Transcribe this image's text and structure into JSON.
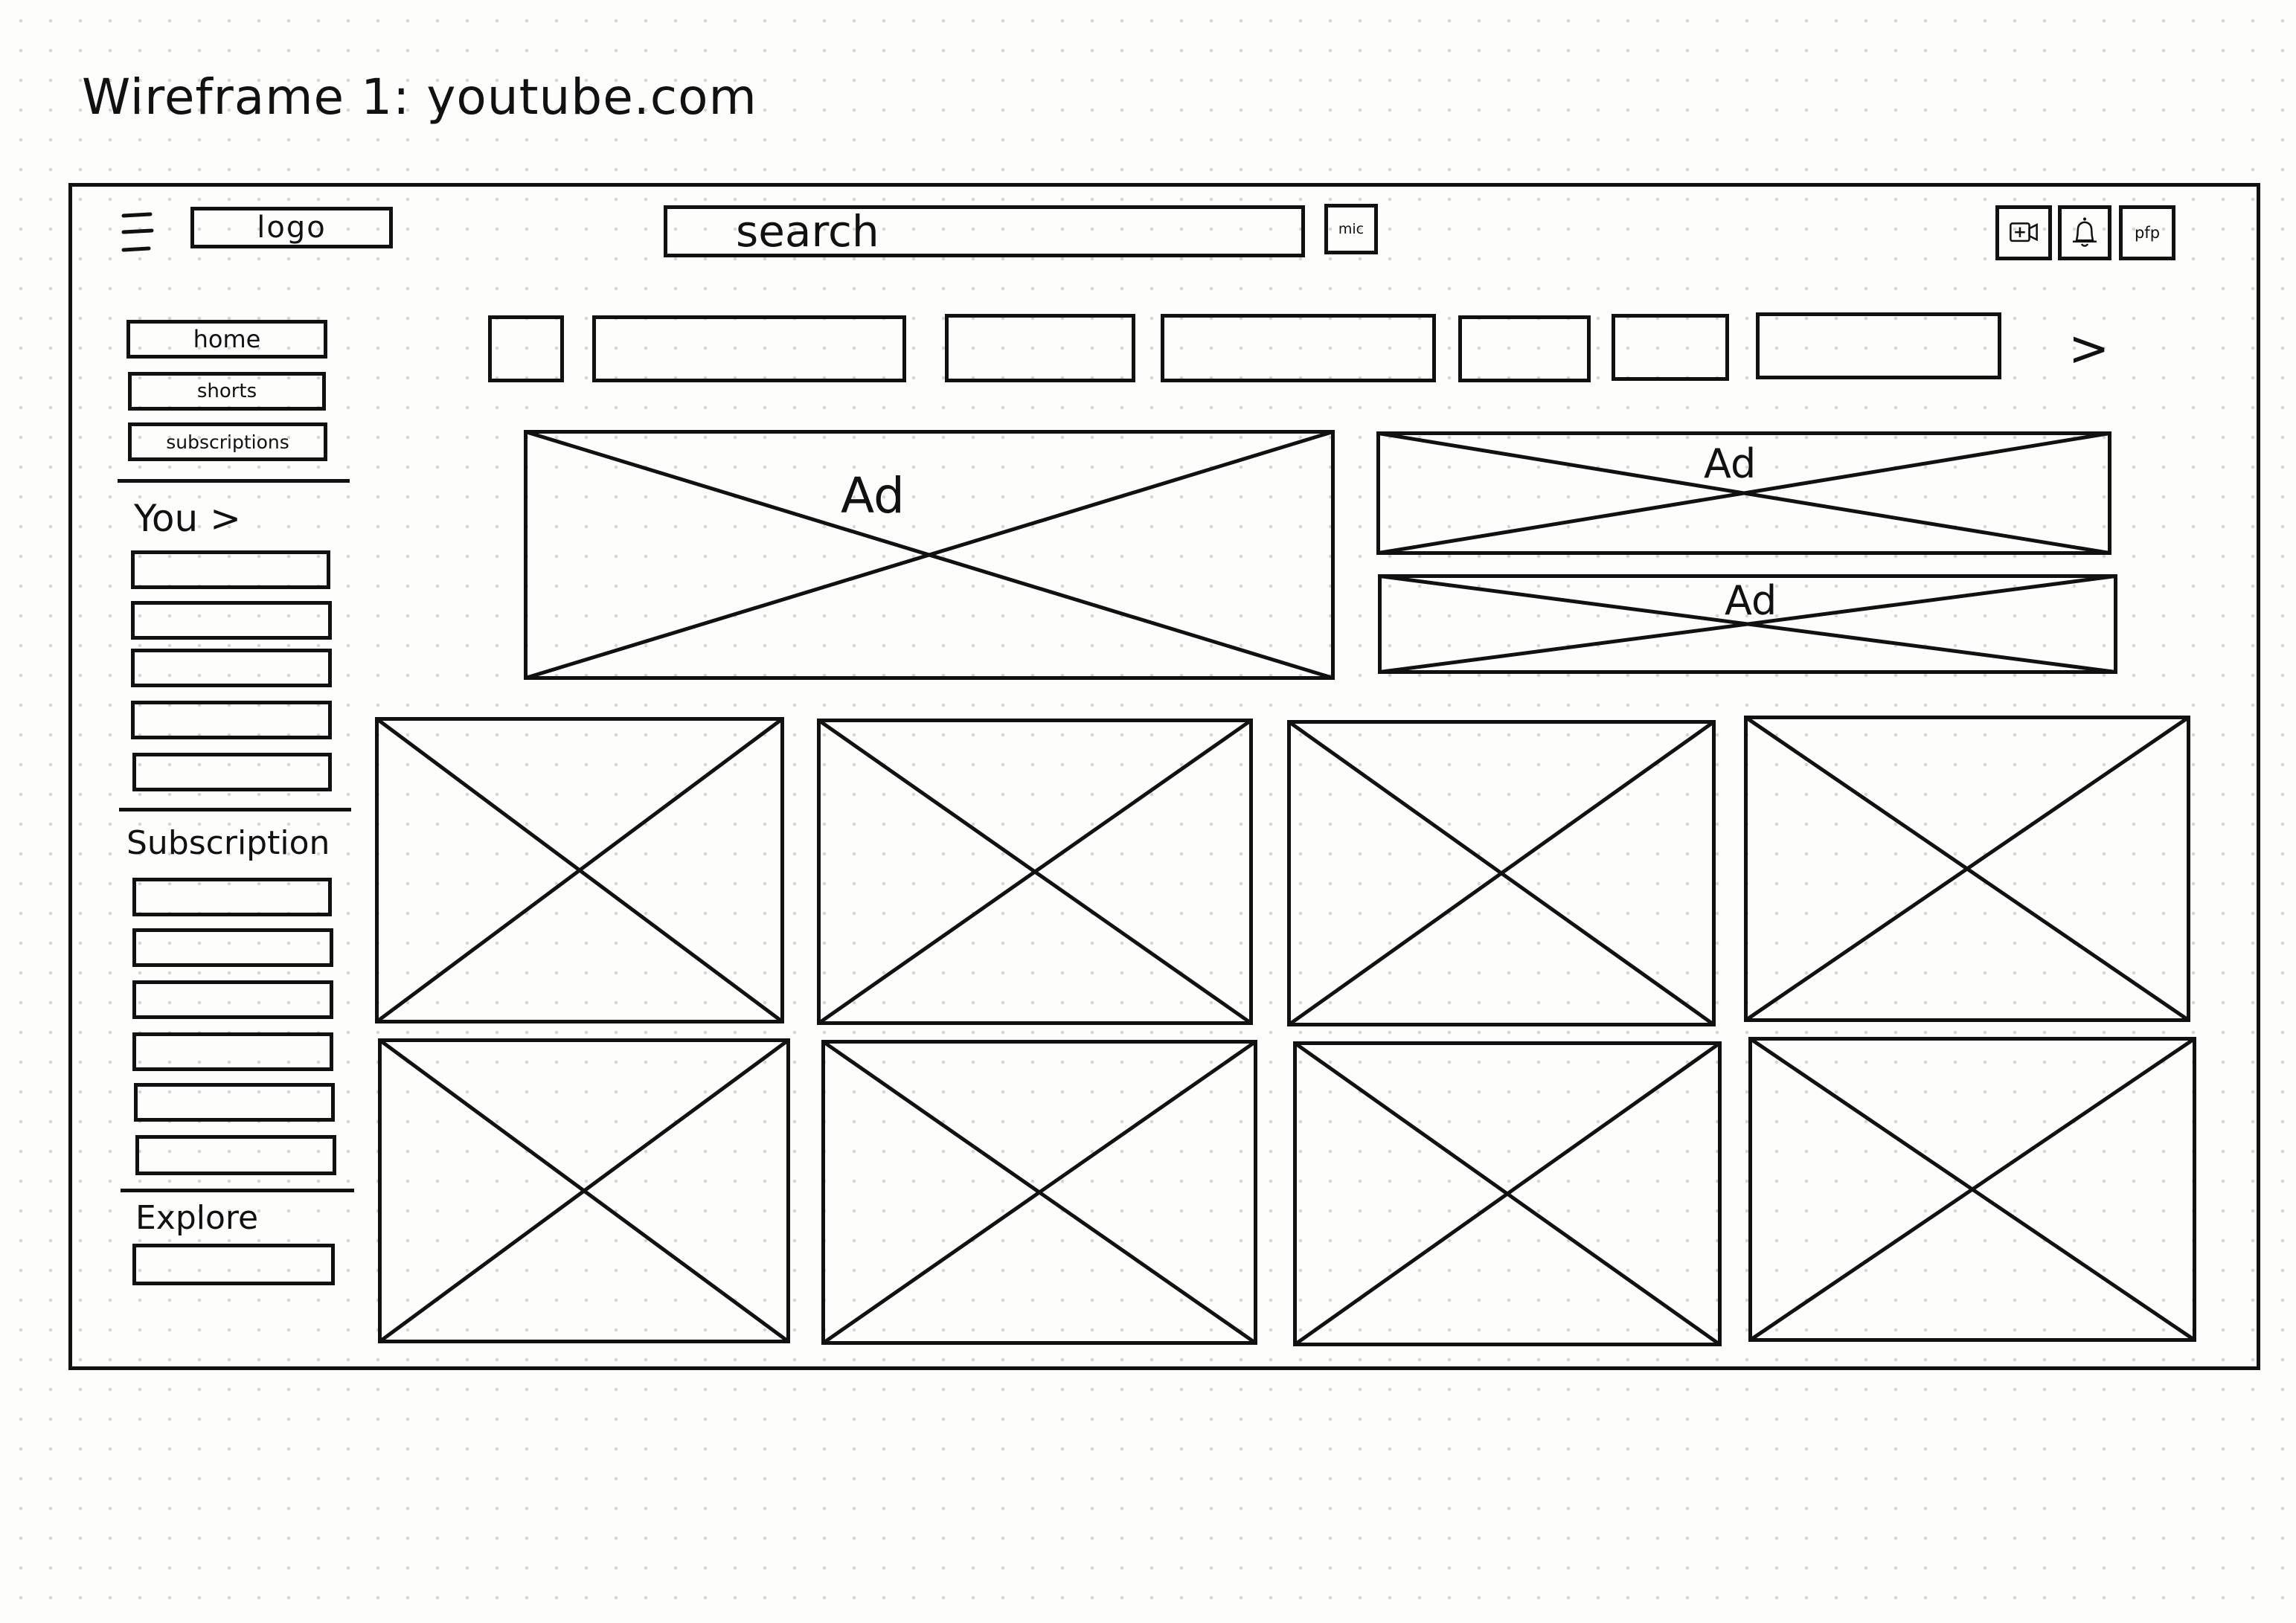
{
  "title": "Wireframe 1: youtube.com",
  "header": {
    "menu_icon": "hamburger-menu-icon",
    "logo_label": "logo",
    "search_label": "search",
    "mic_label": "mic",
    "create_icon": "create-video-icon",
    "bell_icon": "notification-bell-icon",
    "pfp_label": "pfp"
  },
  "chip_bar": {
    "chip_count": 7,
    "next_arrow": ">"
  },
  "ads": {
    "main_label": "Ad",
    "side_top_label": "Ad",
    "side_bottom_label": "Ad"
  },
  "sidebar": {
    "items": [
      "home",
      "shorts",
      "subscriptions"
    ],
    "you_heading": "You >",
    "you_item_count": 5,
    "subscriptions_heading": "Subscription",
    "subscription_item_count": 6,
    "explore_heading": "Explore",
    "explore_item_count": 1
  },
  "video_grid": {
    "rows": 2,
    "columns": 4
  },
  "colors": {
    "ink": "#111111",
    "paper": "#fdfdfc",
    "dot_grid": "#d4d4d2"
  }
}
